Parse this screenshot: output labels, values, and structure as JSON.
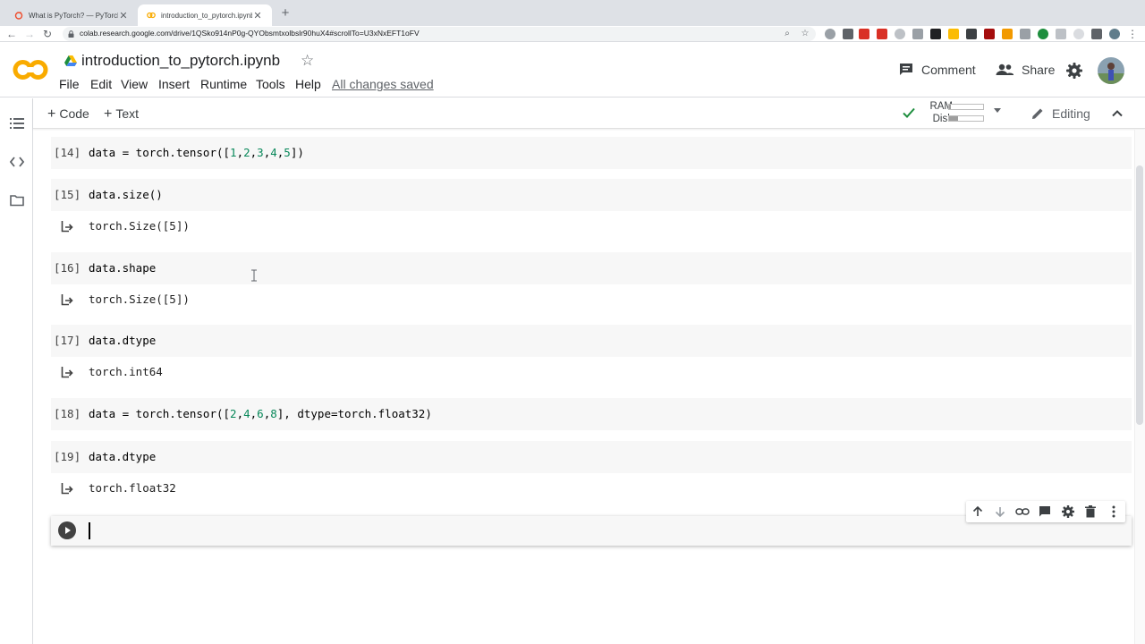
{
  "browser": {
    "tabs": [
      {
        "title": "What is PyTorch? — PyTorch Tu",
        "active": false,
        "favicon": "pytorch-icon"
      },
      {
        "title": "introduction_to_pytorch.ipynb",
        "active": true,
        "favicon": "colab-icon"
      }
    ],
    "url": "colab.research.google.com/drive/1QSko914nP0g-QYObsmtxolbslr90huX4#scrollTo=U3xNxEFT1oFV"
  },
  "header": {
    "logo": "CO",
    "notebook_title": "introduction_to_pytorch.ipynb",
    "menu": [
      "File",
      "Edit",
      "View",
      "Insert",
      "Runtime",
      "Tools",
      "Help"
    ],
    "save_status": "All changes saved",
    "comment_label": "Comment",
    "share_label": "Share"
  },
  "toolbar": {
    "add_code_label": "Code",
    "add_text_label": "Text",
    "ram_label": "RAM",
    "disk_label": "Disk",
    "ram_usage": 0.05,
    "disk_usage": 0.25,
    "editing_label": "Editing"
  },
  "cells": [
    {
      "exec": "[14]",
      "code": "data = torch.tensor([1,2,3,4,5])",
      "output": null
    },
    {
      "exec": "[15]",
      "code": "data.size()",
      "output": "torch.Size([5])"
    },
    {
      "exec": "[16]",
      "code": "data.shape",
      "output": "torch.Size([5])"
    },
    {
      "exec": "[17]",
      "code": "data.dtype",
      "output": "torch.int64"
    },
    {
      "exec": "[18]",
      "code": "data = torch.tensor([2,4,6,8], dtype=torch.float32)",
      "output": null
    },
    {
      "exec": "[19]",
      "code": "data.dtype",
      "output": "torch.float32"
    }
  ],
  "active_cell": {
    "code": ""
  },
  "colors": {
    "accent_orange": "#f9ab00",
    "check_green": "#1e8e3e",
    "code_number": "#09885a"
  }
}
